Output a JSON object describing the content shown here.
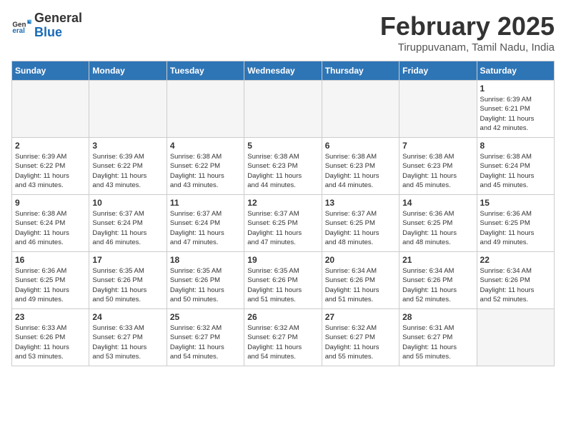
{
  "header": {
    "logo_general": "General",
    "logo_blue": "Blue",
    "month_year": "February 2025",
    "location": "Tiruppuvanam, Tamil Nadu, India"
  },
  "weekdays": [
    "Sunday",
    "Monday",
    "Tuesday",
    "Wednesday",
    "Thursday",
    "Friday",
    "Saturday"
  ],
  "weeks": [
    [
      {
        "day": "",
        "info": ""
      },
      {
        "day": "",
        "info": ""
      },
      {
        "day": "",
        "info": ""
      },
      {
        "day": "",
        "info": ""
      },
      {
        "day": "",
        "info": ""
      },
      {
        "day": "",
        "info": ""
      },
      {
        "day": "1",
        "info": "Sunrise: 6:39 AM\nSunset: 6:21 PM\nDaylight: 11 hours\nand 42 minutes."
      }
    ],
    [
      {
        "day": "2",
        "info": "Sunrise: 6:39 AM\nSunset: 6:22 PM\nDaylight: 11 hours\nand 43 minutes."
      },
      {
        "day": "3",
        "info": "Sunrise: 6:39 AM\nSunset: 6:22 PM\nDaylight: 11 hours\nand 43 minutes."
      },
      {
        "day": "4",
        "info": "Sunrise: 6:38 AM\nSunset: 6:22 PM\nDaylight: 11 hours\nand 43 minutes."
      },
      {
        "day": "5",
        "info": "Sunrise: 6:38 AM\nSunset: 6:23 PM\nDaylight: 11 hours\nand 44 minutes."
      },
      {
        "day": "6",
        "info": "Sunrise: 6:38 AM\nSunset: 6:23 PM\nDaylight: 11 hours\nand 44 minutes."
      },
      {
        "day": "7",
        "info": "Sunrise: 6:38 AM\nSunset: 6:23 PM\nDaylight: 11 hours\nand 45 minutes."
      },
      {
        "day": "8",
        "info": "Sunrise: 6:38 AM\nSunset: 6:24 PM\nDaylight: 11 hours\nand 45 minutes."
      }
    ],
    [
      {
        "day": "9",
        "info": "Sunrise: 6:38 AM\nSunset: 6:24 PM\nDaylight: 11 hours\nand 46 minutes."
      },
      {
        "day": "10",
        "info": "Sunrise: 6:37 AM\nSunset: 6:24 PM\nDaylight: 11 hours\nand 46 minutes."
      },
      {
        "day": "11",
        "info": "Sunrise: 6:37 AM\nSunset: 6:24 PM\nDaylight: 11 hours\nand 47 minutes."
      },
      {
        "day": "12",
        "info": "Sunrise: 6:37 AM\nSunset: 6:25 PM\nDaylight: 11 hours\nand 47 minutes."
      },
      {
        "day": "13",
        "info": "Sunrise: 6:37 AM\nSunset: 6:25 PM\nDaylight: 11 hours\nand 48 minutes."
      },
      {
        "day": "14",
        "info": "Sunrise: 6:36 AM\nSunset: 6:25 PM\nDaylight: 11 hours\nand 48 minutes."
      },
      {
        "day": "15",
        "info": "Sunrise: 6:36 AM\nSunset: 6:25 PM\nDaylight: 11 hours\nand 49 minutes."
      }
    ],
    [
      {
        "day": "16",
        "info": "Sunrise: 6:36 AM\nSunset: 6:25 PM\nDaylight: 11 hours\nand 49 minutes."
      },
      {
        "day": "17",
        "info": "Sunrise: 6:35 AM\nSunset: 6:26 PM\nDaylight: 11 hours\nand 50 minutes."
      },
      {
        "day": "18",
        "info": "Sunrise: 6:35 AM\nSunset: 6:26 PM\nDaylight: 11 hours\nand 50 minutes."
      },
      {
        "day": "19",
        "info": "Sunrise: 6:35 AM\nSunset: 6:26 PM\nDaylight: 11 hours\nand 51 minutes."
      },
      {
        "day": "20",
        "info": "Sunrise: 6:34 AM\nSunset: 6:26 PM\nDaylight: 11 hours\nand 51 minutes."
      },
      {
        "day": "21",
        "info": "Sunrise: 6:34 AM\nSunset: 6:26 PM\nDaylight: 11 hours\nand 52 minutes."
      },
      {
        "day": "22",
        "info": "Sunrise: 6:34 AM\nSunset: 6:26 PM\nDaylight: 11 hours\nand 52 minutes."
      }
    ],
    [
      {
        "day": "23",
        "info": "Sunrise: 6:33 AM\nSunset: 6:26 PM\nDaylight: 11 hours\nand 53 minutes."
      },
      {
        "day": "24",
        "info": "Sunrise: 6:33 AM\nSunset: 6:27 PM\nDaylight: 11 hours\nand 53 minutes."
      },
      {
        "day": "25",
        "info": "Sunrise: 6:32 AM\nSunset: 6:27 PM\nDaylight: 11 hours\nand 54 minutes."
      },
      {
        "day": "26",
        "info": "Sunrise: 6:32 AM\nSunset: 6:27 PM\nDaylight: 11 hours\nand 54 minutes."
      },
      {
        "day": "27",
        "info": "Sunrise: 6:32 AM\nSunset: 6:27 PM\nDaylight: 11 hours\nand 55 minutes."
      },
      {
        "day": "28",
        "info": "Sunrise: 6:31 AM\nSunset: 6:27 PM\nDaylight: 11 hours\nand 55 minutes."
      },
      {
        "day": "",
        "info": ""
      }
    ]
  ]
}
